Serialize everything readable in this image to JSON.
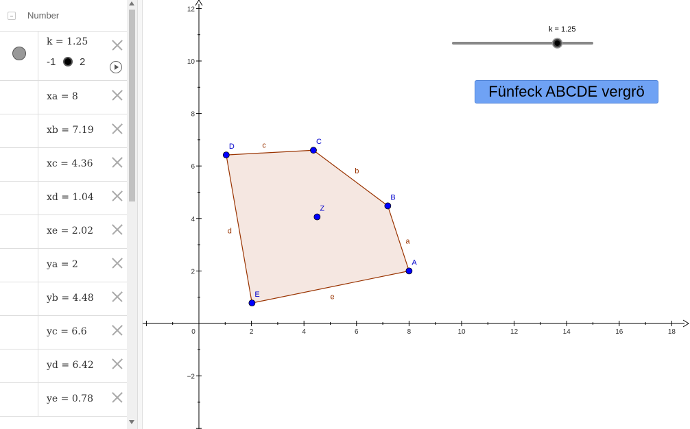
{
  "algebra": {
    "header_label": "Number",
    "slider_k": {
      "expr": "k = 1.25",
      "min": "-1",
      "max": "2",
      "value": 1.25
    },
    "rows": [
      {
        "expr": "xa = 8"
      },
      {
        "expr": "xb = 7.19"
      },
      {
        "expr": "xc = 4.36"
      },
      {
        "expr": "xd = 1.04"
      },
      {
        "expr": "xe = 2.02"
      },
      {
        "expr": "ya = 2"
      },
      {
        "expr": "yb = 4.48"
      },
      {
        "expr": "yc = 6.6"
      },
      {
        "expr": "yd = 6.42"
      },
      {
        "expr": "ye = 0.78"
      }
    ]
  },
  "graphics": {
    "slider_label": "k = 1.25",
    "slider_value": 1.25,
    "slider_min": -1,
    "slider_max": 2,
    "button_label": "Fünfeck ABCDE vergrö",
    "x_ticks": [
      "2",
      "4",
      "6",
      "8",
      "10",
      "12",
      "14",
      "16",
      "18"
    ],
    "y_ticks": [
      "12",
      "10",
      "8",
      "6",
      "4",
      "2",
      "−2"
    ],
    "origin_label": "0",
    "points": [
      {
        "name": "A",
        "x": 8,
        "y": 2
      },
      {
        "name": "B",
        "x": 7.19,
        "y": 4.48
      },
      {
        "name": "C",
        "x": 4.36,
        "y": 6.6
      },
      {
        "name": "D",
        "x": 1.04,
        "y": 6.42
      },
      {
        "name": "E",
        "x": 2.02,
        "y": 0.78
      },
      {
        "name": "Z",
        "x": 4.5,
        "y": 4.06
      }
    ],
    "segments": [
      {
        "name": "a",
        "from": "A",
        "to": "B"
      },
      {
        "name": "b",
        "from": "B",
        "to": "C"
      },
      {
        "name": "c",
        "from": "C",
        "to": "D"
      },
      {
        "name": "d",
        "from": "D",
        "to": "E"
      },
      {
        "name": "e",
        "from": "E",
        "to": "A"
      }
    ],
    "colors": {
      "point": "#0000ff",
      "polygon_stroke": "#993300",
      "polygon_fill": "#f5e7e1",
      "label": "#0000cc",
      "segment_label": "#993300"
    }
  }
}
